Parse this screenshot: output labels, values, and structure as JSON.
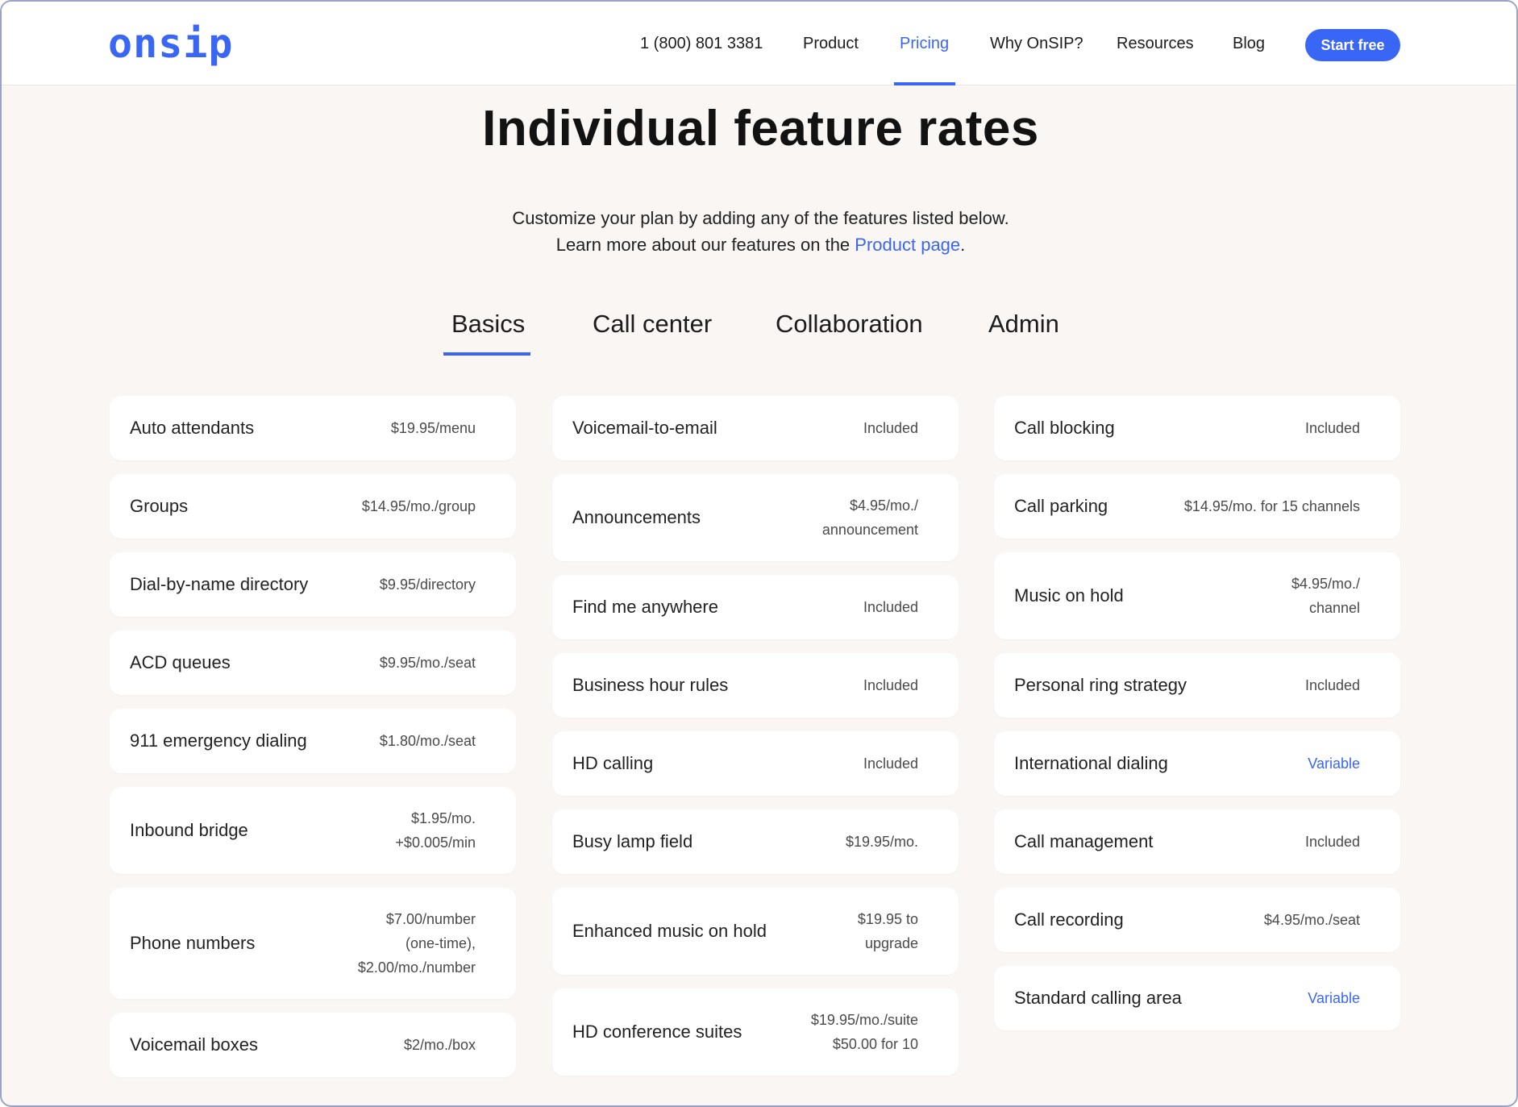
{
  "header": {
    "logo": "onsip",
    "phone": "1 (800) 801 3381",
    "nav": [
      "Product",
      "Pricing",
      "Why OnSIP?",
      "Resources",
      "Blog"
    ],
    "active_nav": "Pricing",
    "cta": "Start free"
  },
  "main": {
    "title": "Individual feature rates",
    "subtitle_line1": "Customize your plan by adding any of the features listed below.",
    "subtitle_line2_prefix": "Learn more about our features on the ",
    "subtitle_link": "Product page",
    "subtitle_line2_suffix": ".",
    "tabs": [
      "Basics",
      "Call center",
      "Collaboration",
      "Admin"
    ],
    "active_tab": "Basics"
  },
  "columns": [
    [
      {
        "name": "Auto attendants",
        "price": [
          "$19.95/menu"
        ]
      },
      {
        "name": "Groups",
        "price": [
          "$14.95/mo./group"
        ]
      },
      {
        "name": "Dial-by-name directory",
        "price": [
          "$9.95/directory"
        ]
      },
      {
        "name": "ACD queues",
        "price": [
          "$9.95/mo./seat"
        ]
      },
      {
        "name": "911 emergency dialing",
        "price": [
          "$1.80/mo./seat"
        ]
      },
      {
        "name": "Inbound bridge",
        "price": [
          "$1.95/mo.",
          "+$0.005/min"
        ]
      },
      {
        "name": "Phone numbers",
        "price": [
          "$7.00/number",
          "(one-time),",
          "$2.00/mo./number"
        ]
      },
      {
        "name": "Voicemail boxes",
        "price": [
          "$2/mo./box"
        ]
      }
    ],
    [
      {
        "name": "Voicemail-to-email",
        "price": [
          "Included"
        ]
      },
      {
        "name": "Announcements",
        "price": [
          "$4.95/mo./",
          "announcement"
        ]
      },
      {
        "name": "Find me anywhere",
        "price": [
          "Included"
        ]
      },
      {
        "name": "Business hour rules",
        "price": [
          "Included"
        ]
      },
      {
        "name": "HD calling",
        "price": [
          "Included"
        ]
      },
      {
        "name": "Busy lamp field",
        "price": [
          "$19.95/mo."
        ]
      },
      {
        "name": "Enhanced music on hold",
        "price": [
          "$19.95 to",
          "upgrade"
        ]
      },
      {
        "name": "HD conference suites",
        "price": [
          "$19.95/mo./suite",
          "$50.00 for 10"
        ]
      }
    ],
    [
      {
        "name": "Call blocking",
        "price": [
          "Included"
        ]
      },
      {
        "name": "Call parking",
        "price": [
          "$14.95/mo. for 15 channels"
        ]
      },
      {
        "name": "Music on hold",
        "price": [
          "$4.95/mo./",
          "channel"
        ]
      },
      {
        "name": "Personal ring strategy",
        "price": [
          "Included"
        ]
      },
      {
        "name": "International dialing",
        "price": [
          "Variable"
        ],
        "variable": true
      },
      {
        "name": "Call management",
        "price": [
          "Included"
        ]
      },
      {
        "name": "Call recording",
        "price": [
          "$4.95/mo./seat"
        ]
      },
      {
        "name": "Standard calling area",
        "price": [
          "Variable"
        ],
        "variable": true
      }
    ]
  ],
  "colors": {
    "accent": "#3a66f5",
    "background": "#faf6f3",
    "card": "#ffffff"
  }
}
